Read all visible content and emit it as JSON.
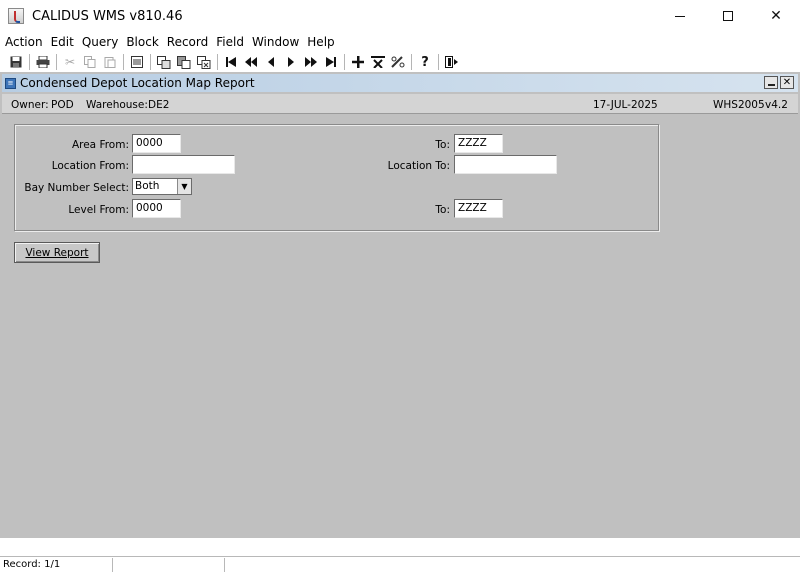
{
  "window": {
    "title": "CALIDUS WMS v810.46",
    "controls": {
      "minimize": "—",
      "maximize": "☐",
      "close": "✕"
    }
  },
  "menu": [
    "Action",
    "Edit",
    "Query",
    "Block",
    "Record",
    "Field",
    "Window",
    "Help"
  ],
  "toolbar": {
    "icons": [
      "save-icon",
      "print-icon",
      "cut-icon",
      "copy-icon",
      "paste-icon",
      "list-icon",
      "copy-record-icon",
      "paste-record-icon",
      "duplicate-record-icon",
      "first-record-icon",
      "previous-block-icon",
      "previous-record-icon",
      "next-record-icon",
      "next-block-icon",
      "last-record-icon",
      "insert-record-icon",
      "delete-record-icon",
      "edit-icon",
      "help-icon",
      "exit-icon"
    ]
  },
  "inner_window": {
    "title": "Condensed Depot Location Map Report"
  },
  "header": {
    "owner_label": "Owner:",
    "owner_value": "POD",
    "warehouse_label": "Warehouse:",
    "warehouse_value": "DE2",
    "date": "17-JUL-2025",
    "module": "WHS2005",
    "version": "v4.2"
  },
  "form": {
    "area_from_label": "Area From:",
    "area_from_value": "0000",
    "area_to_label": "To:",
    "area_to_value": "ZZZZ",
    "location_from_label": "Location From:",
    "location_from_value": "",
    "location_to_label": "Location To:",
    "location_to_value": "",
    "bay_label": "Bay Number Select:",
    "bay_value": "Both",
    "level_from_label": "Level From:",
    "level_from_value": "0000",
    "level_to_label": "To:",
    "level_to_value": "ZZZZ"
  },
  "actions": {
    "view_report": "View Report"
  },
  "status": {
    "record": "Record: 1/1"
  }
}
